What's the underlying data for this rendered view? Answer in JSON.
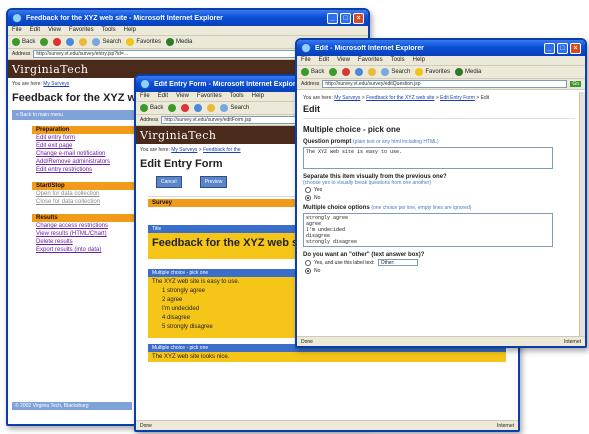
{
  "browser": {
    "menu": [
      "File",
      "Edit",
      "View",
      "Favorites",
      "Tools",
      "Help"
    ],
    "toolbar": {
      "back": "Back",
      "search": "Search",
      "favorites": "Favorites",
      "media": "Media"
    },
    "address_label": "Address",
    "go": "Go",
    "status_internet": "Internet",
    "status_done": "Done"
  },
  "win1": {
    "title": "Feedback for the XYZ web site - Microsoft Internet Explorer",
    "address": "http://survey.vt.edu/survey/entry.jsp?id=...",
    "banner": "VirginiaTech",
    "breadcrumb_prefix": "You are here:",
    "breadcrumb_link": "My Surveys",
    "page_title": "Feedback for the XYZ web site",
    "back_button": "« Back to main menu",
    "sections": [
      {
        "head": "Preparation",
        "links": [
          "Edit entry form",
          "Edit exit page",
          "Change e-mail notification",
          "Add/Remove administrators",
          "Edit entry restrictions"
        ]
      },
      {
        "head": "Start/Stop",
        "links": [
          "Open for data collection",
          "Close for data collection"
        ]
      },
      {
        "head": "Results",
        "links": [
          "Change access restrictions",
          "View results (HTML/Chart)",
          "Delete results",
          "Export results (into data)"
        ]
      }
    ],
    "footer": "© 2002 Virginia Tech, Blacksburg"
  },
  "win2": {
    "title": "Edit Entry Form - Microsoft Internet Explorer",
    "address": "http://survey.vt.edu/survey/editForm.jsp",
    "banner": "VirginiaTech",
    "breadcrumb_prefix": "You are here:",
    "breadcrumb_links": [
      "My Surveys",
      "Feedback for the"
    ],
    "page_title": "Edit Entry Form",
    "buttons": [
      "Cancel",
      "Preview"
    ],
    "survey_label": "Survey",
    "title_label": "Title",
    "survey_title": "Feedback for the XYZ web site",
    "question_strip": "Multiple choice - pick one",
    "question_text": "The XYZ web site is easy to use.",
    "options": [
      "strongly agree",
      "agree",
      "I'm undecided",
      "disagree",
      "strongly disagree"
    ],
    "question_strip_2": "Multiple choice - pick one",
    "question_text_2": "The XYZ web site looks nice."
  },
  "win3": {
    "title": "Edit - Microsoft Internet Explorer",
    "address": "http://survey.vt.edu/survey/editQuestion.jsp",
    "breadcrumb_prefix": "You are here:",
    "breadcrumb_links": [
      "My Surveys",
      "Feedback for the XYZ web site",
      "Edit Entry Form"
    ],
    "crumb_current": "Edit",
    "page_heading": "Edit",
    "subheading": "Multiple choice - pick one",
    "prompt_label": "Question prompt",
    "prompt_hint": "(plain text or any html including HTML)",
    "prompt_value": "The XYZ web site is easy to use.",
    "separate_label": "Separate this item visually from the previous one?",
    "separate_hint": "(choose yes to visually break questions from one another)",
    "separate_yes": "Yes",
    "separate_no": "No",
    "choice_label": "Multiple choice options",
    "choice_hint": "(one choice per line, empty lines are ignored)",
    "choice_options": [
      "strongly agree",
      "agree",
      "I'm undecided",
      "disagree",
      "strongly disagree"
    ],
    "other_label": "Do you want an \"other\" (text answer box)?",
    "other_yes": "Yes, and use this label text:",
    "other_value": "Other:",
    "other_no": "No",
    "status": "Done"
  }
}
